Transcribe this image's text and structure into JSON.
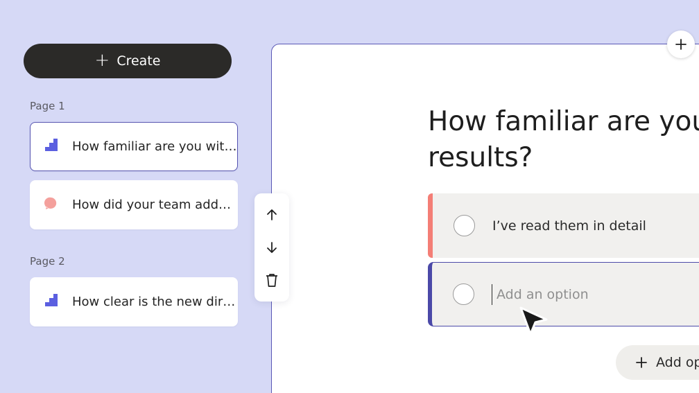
{
  "sidebar": {
    "create_label": "Create",
    "pages": [
      {
        "label": "Page 1",
        "questions": [
          {
            "text": "How familiar are you wit…",
            "icon": "rating-steps-icon",
            "selected": true
          },
          {
            "text": "How did your team add…",
            "icon": "speech-bubble-icon",
            "selected": false
          }
        ]
      },
      {
        "label": "Page 2",
        "questions": [
          {
            "text": "How clear is the new dir…",
            "icon": "rating-steps-icon",
            "selected": false
          }
        ]
      }
    ]
  },
  "toolbar": {
    "items": [
      "move-up-icon",
      "move-down-icon",
      "trash-icon"
    ]
  },
  "editor": {
    "question_line1": "How familiar are you w",
    "question_line2": "results?",
    "options": [
      {
        "text": "I’ve read them in detail"
      }
    ],
    "new_option_placeholder": "Add an option",
    "add_option_label": "Add op"
  },
  "colors": {
    "background": "#d6d9f6",
    "accent": "#5553b0",
    "option_accent": "#f47e76",
    "dark_button": "#2b2a28",
    "steps_icon": "#5b5fe0",
    "bubble_icon": "#f4a09c"
  }
}
